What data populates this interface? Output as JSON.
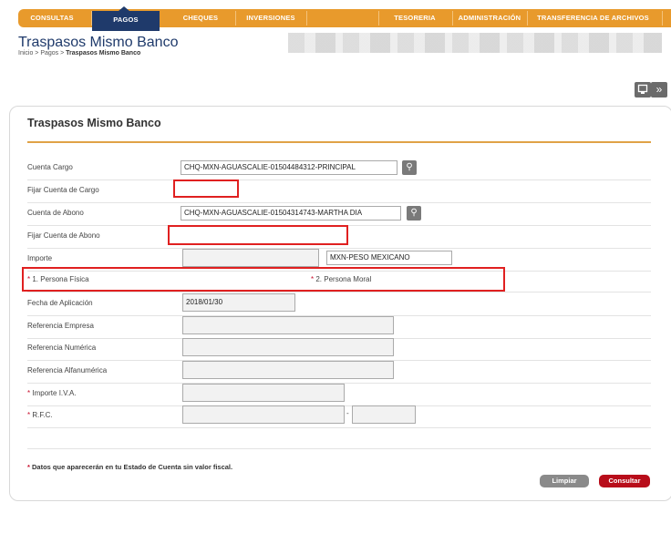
{
  "nav": {
    "tabs": [
      {
        "label": "CONSULTAS"
      },
      {
        "label": "PAGOS"
      },
      {
        "label": "CHEQUES"
      },
      {
        "label": "INVERSIONES"
      },
      {
        "label": "TESORERIA"
      },
      {
        "label": "ADMINISTRACIÓN"
      },
      {
        "label": "TRANSFERENCIA DE ARCHIVOS"
      }
    ],
    "active": "PAGOS"
  },
  "header": {
    "title": "Traspasos Mismo Banco",
    "breadcrumb_prefix": "Inicio > Pagos > ",
    "breadcrumb_current": "Traspasos Mismo Banco"
  },
  "panel": {
    "title": "Traspasos Mismo Banco",
    "cuenta_cargo_label": "Cuenta Cargo",
    "cuenta_cargo_value": "CHQ-MXN-AGUASCALIE-01504484312-PRINCIPAL",
    "fijar_cargo_label": "Fijar Cuenta de Cargo",
    "cuenta_abono_label": "Cuenta de Abono",
    "cuenta_abono_value": "CHQ-MXN-AGUASCALIE-01504314743-MARTHA DIA",
    "fijar_abono_label": "Fijar Cuenta de Abono",
    "importe_label": "Importe",
    "importe_value": "",
    "moneda_value": "MXN-PESO MEXICANO",
    "persona_fisica_label": "1. Persona Física",
    "persona_moral_label": "2. Persona Moral",
    "fecha_label": "Fecha de Aplicación",
    "fecha_value": "2018/01/30",
    "ref_empresa_label": "Referencia Empresa",
    "ref_numerica_label": "Referencia Numérica",
    "ref_alfa_label": "Referencia Alfanumérica",
    "iva_label": "Importe I.V.A.",
    "rfc_label": "R.F.C.",
    "rfc_sep": "-",
    "note": "Datos que aparecerán en tu Estado de Cuenta sin valor fiscal.",
    "star": "*",
    "limpiar_label": "Limpiar",
    "consultar_label": "Consultar"
  },
  "colors": {
    "nav_orange": "#e89a2c",
    "nav_active": "#1f3a6b",
    "accent_rule": "#e0a246",
    "highlight_box": "#e02020",
    "consultar_button": "#b80d1a"
  },
  "icons": [
    "magnifier-icon",
    "print-icon",
    "double-chevron-right-icon"
  ]
}
